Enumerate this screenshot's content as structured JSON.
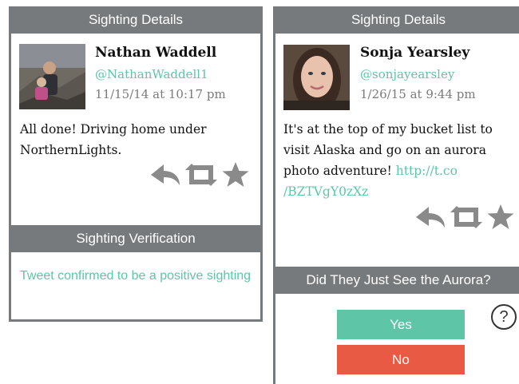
{
  "cards": [
    {
      "header": "Sighting Details",
      "name": "Nathan Waddell",
      "handle": "@NathanWaddell1",
      "timestamp": "11/15/14 at 10:17 pm",
      "text": "All done! Driving home under NorthernLights.",
      "actions": [
        "reply-icon",
        "retweet-icon",
        "favorite-icon"
      ],
      "section_header": "Sighting Verification",
      "verification": "Tweet confirmed to be a positive sighting"
    },
    {
      "header": "Sighting Details",
      "name": "Sonja Yearsley",
      "handle": "@sonjayearsley",
      "timestamp": "1/26/15 at 9:44 pm",
      "text": "It's at the top of my bucket list to visit Alaska and go on an aurora photo adventure! ",
      "link": "http://t.co /BZTVgY0zXz",
      "actions": [
        "reply-icon",
        "retweet-icon",
        "favorite-icon"
      ],
      "question_header": "Did They Just See the Aurora?",
      "yes_label": "Yes",
      "no_label": "No",
      "help_glyph": "?"
    }
  ],
  "colors": {
    "header_gray": "#777a7c",
    "accent_teal": "#5ec5a6",
    "no_red": "#e85a44",
    "icon_gray": "#8a8a8a"
  }
}
